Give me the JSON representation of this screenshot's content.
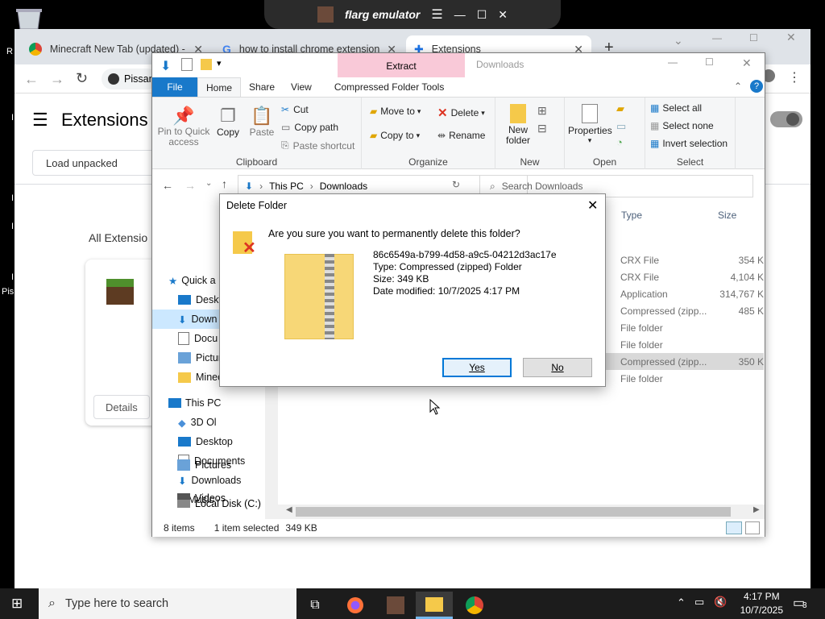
{
  "desktop": {
    "left_labels": [
      "R",
      "I",
      "I",
      "I",
      "I",
      "Pis"
    ]
  },
  "emulator": {
    "title": "flarg emulator"
  },
  "chrome": {
    "tabs": [
      {
        "label": "Minecraft New Tab (updated) - ",
        "active": false
      },
      {
        "label": "how to install chrome extension",
        "active": false
      },
      {
        "label": "Extensions",
        "active": true
      }
    ],
    "profile_label": "Pissan",
    "page_title": "Extensions",
    "load_unpacked": "Load unpacked",
    "all_extensions": "All Extensio",
    "details": "Details"
  },
  "explorer": {
    "title_context": "Extract",
    "title_folder": "Downloads",
    "ribbon_tabs": [
      "File",
      "Home",
      "Share",
      "View",
      "Compressed Folder Tools"
    ],
    "clipboard": {
      "pin": "Pin to Quick access",
      "copy": "Copy",
      "paste": "Paste",
      "cut": "Cut",
      "copy_path": "Copy path",
      "paste_shortcut": "Paste shortcut",
      "label": "Clipboard"
    },
    "organize": {
      "move_to": "Move to",
      "copy_to": "Copy to",
      "delete": "Delete",
      "rename": "Rename",
      "label": "Organize"
    },
    "new_group": {
      "new_folder": "New folder",
      "label": "New"
    },
    "open_group": {
      "properties": "Properties",
      "label": "Open"
    },
    "select_group": {
      "select_all": "Select all",
      "select_none": "Select none",
      "invert": "Invert selection",
      "label": "Select"
    },
    "address": {
      "this_pc": "This PC",
      "downloads": "Downloads"
    },
    "search_placeholder": "Search Downloads",
    "nav": [
      {
        "label": "Quick a",
        "indent": 0
      },
      {
        "label": "Deskt",
        "indent": 1
      },
      {
        "label": "Down",
        "indent": 1,
        "selected": true
      },
      {
        "label": "Docu",
        "indent": 1
      },
      {
        "label": "Pictur",
        "indent": 1
      },
      {
        "label": "Minec",
        "indent": 1
      },
      {
        "label": "This PC",
        "indent": 0
      },
      {
        "label": "3D Ol",
        "indent": 1
      },
      {
        "label": "Desktop",
        "indent": 1
      },
      {
        "label": "Documents",
        "indent": 1
      },
      {
        "label": "Downloads",
        "indent": 1
      },
      {
        "label": "Music",
        "indent": 1
      },
      {
        "label": "Pictures",
        "indent": 1
      },
      {
        "label": "Videos",
        "indent": 1
      },
      {
        "label": "Local Disk (C:)",
        "indent": 1
      }
    ],
    "columns": {
      "type": "Type",
      "size": "Size"
    },
    "rows": [
      {
        "type": "CRX File",
        "size": "354 K"
      },
      {
        "type": "CRX File",
        "size": "4,104 K"
      },
      {
        "type": "Application",
        "size": "314,767 K"
      },
      {
        "type": "Compressed (zipp...",
        "size": "485 K"
      },
      {
        "type": "File folder",
        "size": ""
      },
      {
        "type": "File folder",
        "size": ""
      },
      {
        "type": "Compressed (zipp...",
        "size": "350 K",
        "selected": true
      },
      {
        "type": "File folder",
        "size": ""
      }
    ],
    "status": {
      "items": "8 items",
      "selected": "1 item selected",
      "size": "349 KB"
    }
  },
  "dialog": {
    "title": "Delete Folder",
    "question": "Are you sure you want to permanently delete this folder?",
    "name": "86c6549a-b799-4d58-a9c5-04212d3ac17e",
    "type": "Type: Compressed (zipped) Folder",
    "size": "Size: 349 KB",
    "modified": "Date modified: 10/7/2025 4:17 PM",
    "yes": "Yes",
    "no": "No"
  },
  "taskbar": {
    "search_placeholder": "Type here to search",
    "time": "4:17 PM",
    "date": "10/7/2025",
    "notification_count": "3"
  }
}
